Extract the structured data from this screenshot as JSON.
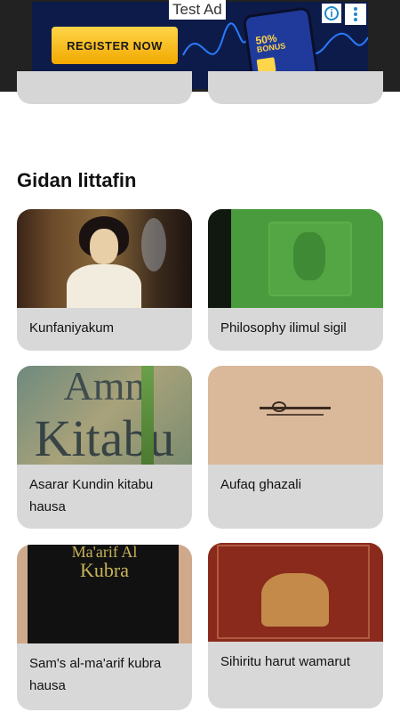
{
  "ad": {
    "label": "Test Ad",
    "cta": "REGISTER NOW",
    "bonus_percent": "50%",
    "bonus_word": "BONUS"
  },
  "section": {
    "title": "Gidan littafin"
  },
  "books": [
    {
      "title": "Kunfaniyakum",
      "icon": "book-cover-portrait"
    },
    {
      "title": "Philosophy ilimul sigil",
      "icon": "book-cover-green"
    },
    {
      "title": "Asarar Kundin kitabu hausa",
      "icon": "book-cover-calligraphy"
    },
    {
      "title": "Aufaq ghazali",
      "icon": "book-cover-manuscript"
    },
    {
      "title": "Sam's al-ma'arif kubra hausa",
      "icon": "book-cover-black"
    },
    {
      "title": "Sihiritu harut wamarut",
      "icon": "book-cover-red"
    }
  ],
  "colors": {
    "card_bg": "#d8d8d8",
    "ad_bg": "#0d1b4a",
    "ad_cta": "#f2a900"
  }
}
